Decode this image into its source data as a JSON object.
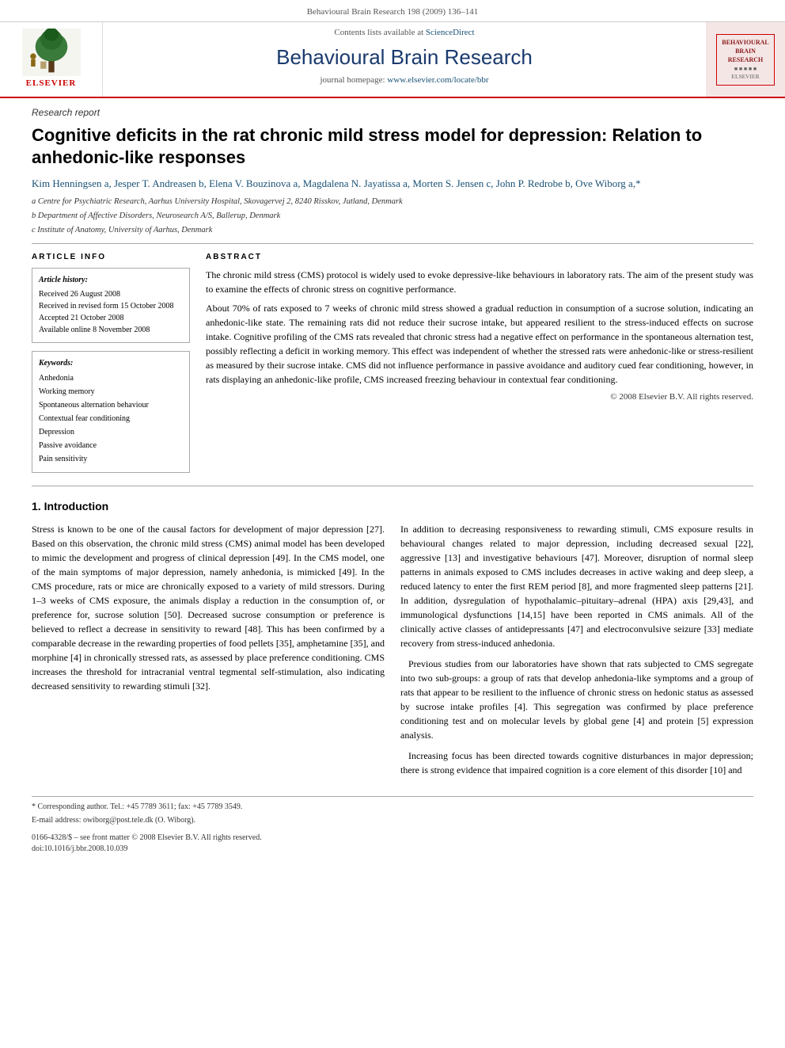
{
  "meta": {
    "journal_ref": "Behavioural Brain Research 198 (2009) 136–141"
  },
  "header": {
    "sciencedirect_text": "Contents lists available at",
    "sciencedirect_link": "ScienceDirect",
    "journal_title": "Behavioural Brain Research",
    "homepage_text": "journal homepage:",
    "homepage_link": "www.elsevier.com/locate/bbr",
    "badge_line1": "BEHAVIOURAL",
    "badge_line2": "BRAIN",
    "badge_line3": "RESEARCH"
  },
  "article": {
    "type": "Research report",
    "title": "Cognitive deficits in the rat chronic mild stress model for depression: Relation to anhedonic-like responses",
    "authors": "Kim Henningsen a, Jesper T. Andreasen b, Elena V. Bouzinova a, Magdalena N. Jayatissa a, Morten S. Jensen c, John P. Redrobe b, Ove Wiborg a,*",
    "affiliations": [
      "a Centre for Psychiatric Research, Aarhus University Hospital, Skovagervej 2, 8240 Risskov, Jutland, Denmark",
      "b Department of Affective Disorders, Neurosearch A/S, Ballerup, Denmark",
      "c Institute of Anatomy, University of Aarhus, Denmark"
    ],
    "article_info": {
      "label": "Article history:",
      "received": "Received 26 August 2008",
      "revised": "Received in revised form 15 October 2008",
      "accepted": "Accepted 21 October 2008",
      "online": "Available online 8 November 2008"
    },
    "keywords_label": "Keywords:",
    "keywords": [
      "Anhedonia",
      "Working memory",
      "Spontaneous alternation behaviour",
      "Contextual fear conditioning",
      "Depression",
      "Passive avoidance",
      "Pain sensitivity"
    ],
    "abstract_label": "ABSTRACT",
    "abstract_p1": "The chronic mild stress (CMS) protocol is widely used to evoke depressive-like behaviours in laboratory rats. The aim of the present study was to examine the effects of chronic stress on cognitive performance.",
    "abstract_p2": "About 70% of rats exposed to 7 weeks of chronic mild stress showed a gradual reduction in consumption of a sucrose solution, indicating an anhedonic-like state. The remaining rats did not reduce their sucrose intake, but appeared resilient to the stress-induced effects on sucrose intake. Cognitive profiling of the CMS rats revealed that chronic stress had a negative effect on performance in the spontaneous alternation test, possibly reflecting a deficit in working memory. This effect was independent of whether the stressed rats were anhedonic-like or stress-resilient as measured by their sucrose intake. CMS did not influence performance in passive avoidance and auditory cued fear conditioning, however, in rats displaying an anhedonic-like profile, CMS increased freezing behaviour in contextual fear conditioning.",
    "copyright": "© 2008 Elsevier B.V. All rights reserved.",
    "article_info_header": "ARTICLE INFO",
    "intro_header": "1.  Introduction",
    "intro_col1_p1": "Stress is known to be one of the causal factors for development of major depression [27]. Based on this observation, the chronic mild stress (CMS) animal model has been developed to mimic the development and progress of clinical depression [49]. In the CMS model, one of the main symptoms of major depression, namely anhedonia, is mimicked [49]. In the CMS procedure, rats or mice are chronically exposed to a variety of mild stressors. During 1–3 weeks of CMS exposure, the animals display a reduction in the consumption of, or preference for, sucrose solution [50]. Decreased sucrose consumption or preference is believed to reflect a decrease in sensitivity to reward [48]. This has been confirmed by a comparable decrease in the rewarding properties of food pellets [35], amphetamine [35], and morphine [4] in chronically stressed rats, as assessed by place preference conditioning. CMS increases the threshold for intracranial ventral tegmental self-stimulation, also indicating decreased sensitivity to rewarding stimuli [32].",
    "intro_col2_p1": "In addition to decreasing responsiveness to rewarding stimuli, CMS exposure results in behavioural changes related to major depression, including decreased sexual [22], aggressive [13] and investigative behaviours [47]. Moreover, disruption of normal sleep patterns in animals exposed to CMS includes decreases in active waking and deep sleep, a reduced latency to enter the first REM period [8], and more fragmented sleep patterns [21]. In addition, dysregulation of hypothalamic–pituitary–adrenal (HPA) axis [29,43], and immunological dysfunctions [14,15] have been reported in CMS animals. All of the clinically active classes of antidepressants [47] and electroconvulsive seizure [33] mediate recovery from stress-induced anhedonia.",
    "intro_col2_p2": "Previous studies from our laboratories have shown that rats subjected to CMS segregate into two sub-groups: a group of rats that develop anhedonia-like symptoms and a group of rats that appear to be resilient to the influence of chronic stress on hedonic status as assessed by sucrose intake profiles [4]. This segregation was confirmed by place preference conditioning test and on molecular levels by global gene [4] and protein [5] expression analysis.",
    "intro_col2_p3": "Increasing focus has been directed towards cognitive disturbances in major depression; there is strong evidence that impaired cognition is a core element of this disorder [10] and",
    "footnote_corresponding": "* Corresponding author. Tel.: +45 7789 3611; fax: +45 7789 3549.",
    "footnote_email": "E-mail address: owiborg@post.tele.dk (O. Wiborg).",
    "issn": "0166-4328/$ – see front matter © 2008 Elsevier B.V. All rights reserved.",
    "doi": "doi:10.1016/j.bbr.2008.10.039"
  }
}
